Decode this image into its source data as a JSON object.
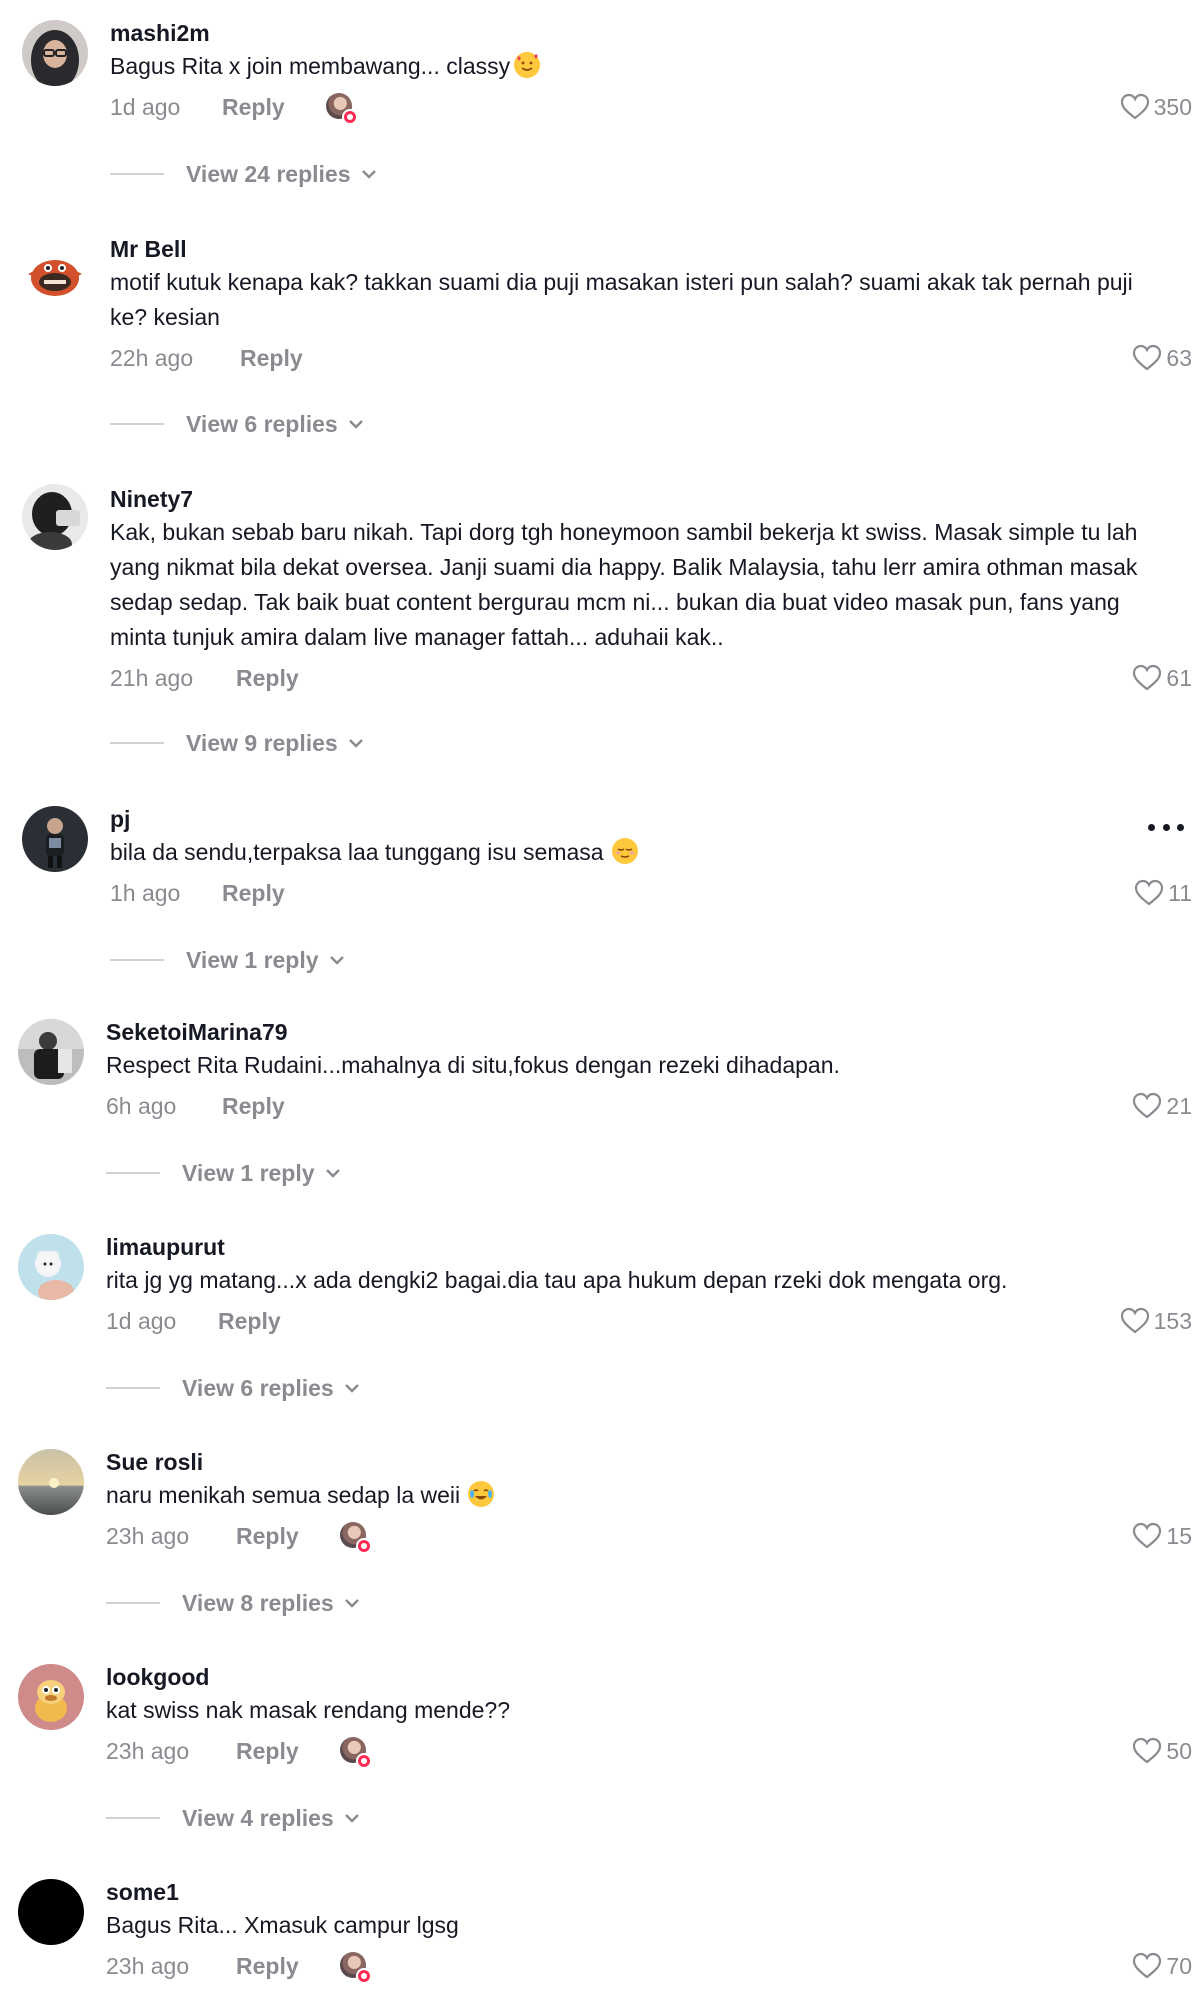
{
  "comments": [
    {
      "username": "mashi2m",
      "text": "Bagus Rita x join membawang... classy",
      "emoji": "smiling-face-with-hearts",
      "time": "1d ago",
      "reply_label": "Reply",
      "creator_liked": true,
      "likes": "350",
      "view_replies": "View 24 replies",
      "more": false
    },
    {
      "username": "Mr Bell",
      "text": "motif kutuk kenapa kak? takkan suami dia puji masakan isteri pun salah? suami akak tak pernah puji ke? kesian",
      "emoji": "",
      "time": "22h ago",
      "reply_label": "Reply",
      "creator_liked": false,
      "likes": "63",
      "view_replies": "View 6 replies",
      "more": false
    },
    {
      "username": "Ninety7",
      "text": "Kak, bukan sebab baru nikah. Tapi dorg tgh honeymoon sambil bekerja kt swiss. Masak simple tu lah yang nikmat bila dekat oversea. Janji suami dia happy. Balik Malaysia, tahu lerr amira othman masak sedap sedap. Tak baik buat content bergurau mcm ni... bukan dia buat video masak pun, fans yang minta tunjuk amira dalam live manager fattah... aduhaii kak..",
      "emoji": "",
      "time": "21h ago",
      "reply_label": "Reply",
      "creator_liked": false,
      "likes": "61",
      "view_replies": "View 9 replies",
      "more": false
    },
    {
      "username": "pj",
      "text": "bila da sendu,terpaksa laa tunggang isu semasa",
      "emoji": "relieved-face",
      "time": "1h ago",
      "reply_label": "Reply",
      "creator_liked": false,
      "likes": "11",
      "view_replies": "View 1 reply",
      "more": true
    },
    {
      "username": "SeketoiMarina79",
      "text": "Respect Rita Rudaini...mahalnya di situ,fokus dengan rezeki dihadapan.",
      "emoji": "",
      "time": "6h ago",
      "reply_label": "Reply",
      "creator_liked": false,
      "likes": "21",
      "view_replies": "View 1 reply",
      "more": false
    },
    {
      "username": "limaupurut",
      "text": "rita jg yg matang...x ada dengki2 bagai.dia tau apa hukum depan rzeki dok mengata org.",
      "emoji": "",
      "time": "1d ago",
      "reply_label": "Reply",
      "creator_liked": false,
      "likes": "153",
      "view_replies": "View 6 replies",
      "more": false
    },
    {
      "username": "Sue rosli",
      "text": "naru menikah semua sedap la weii",
      "emoji": "face-with-tears-of-joy",
      "time": "23h ago",
      "reply_label": "Reply",
      "creator_liked": true,
      "likes": "15",
      "view_replies": "View 8 replies",
      "more": false
    },
    {
      "username": "lookgood",
      "text": "kat swiss nak masak rendang mende??",
      "emoji": "",
      "time": "23h ago",
      "reply_label": "Reply",
      "creator_liked": true,
      "likes": "50",
      "view_replies": "View 4 replies",
      "more": false
    },
    {
      "username": "some1",
      "text": "Bagus Rita... Xmasuk campur lgsg",
      "emoji": "",
      "time": "23h ago",
      "reply_label": "Reply",
      "creator_liked": true,
      "likes": "70",
      "view_replies": "",
      "more": false
    }
  ],
  "colors": {
    "text": "#161823",
    "secondary": "#8a8b91",
    "accent": "#fe2c55"
  }
}
